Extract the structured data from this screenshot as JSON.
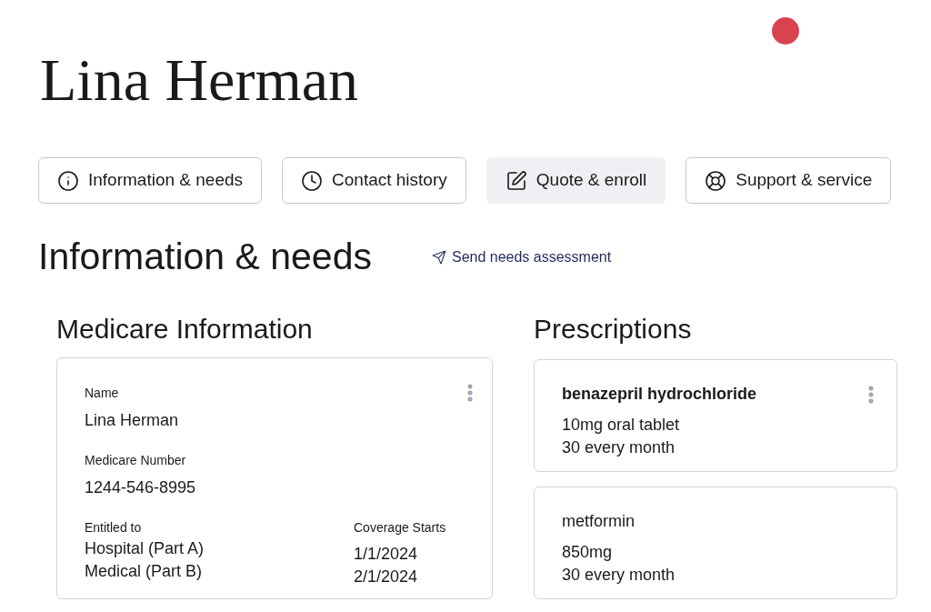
{
  "profile": {
    "name": "Lina Herman"
  },
  "tabs": [
    {
      "label": "Information & needs",
      "kind": "info",
      "selected": false
    },
    {
      "label": "Contact history",
      "kind": "clock",
      "selected": false
    },
    {
      "label": "Quote & enroll",
      "kind": "edit",
      "selected": true
    },
    {
      "label": "Support & service",
      "kind": "lifebuoy",
      "selected": false
    }
  ],
  "section": {
    "title": "Information & needs",
    "action": "Send needs assessment"
  },
  "medicare": {
    "title": "Medicare Information",
    "fields": [
      {
        "label": "Name",
        "value": "Lina Herman"
      },
      {
        "label": "Medicare Number",
        "value": "1244-546-8995"
      }
    ],
    "entitled_label": "Entitled to",
    "coverage_label": "Coverage Starts",
    "coverage": [
      {
        "part": "Hospital (Part A)",
        "start": "1/1/2024"
      },
      {
        "part": "Medical (Part B)",
        "start": "2/1/2024"
      }
    ]
  },
  "prescriptions": {
    "title": "Prescriptions",
    "items": [
      {
        "name": "benazepril hydrochloride",
        "dose": "10mg oral tablet",
        "frequency": "30 every month",
        "menu": true
      },
      {
        "name": "metformin",
        "dose": "850mg",
        "frequency": "30 every month",
        "menu": false
      }
    ]
  }
}
